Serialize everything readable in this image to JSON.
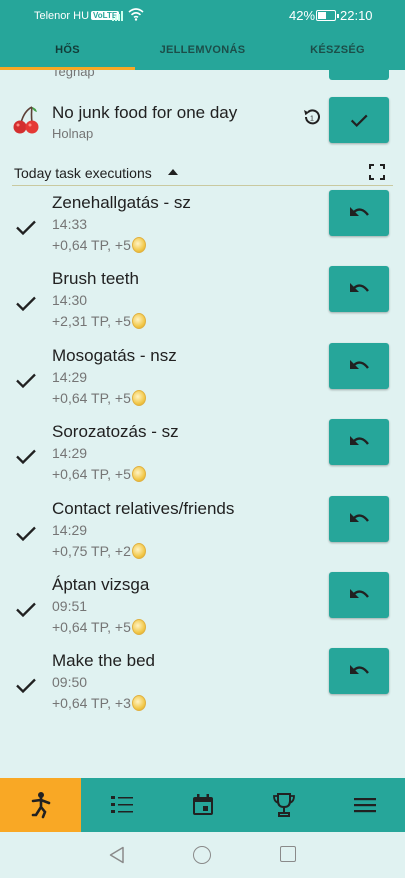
{
  "status_bar": {
    "carrier": "Telenor HU",
    "volte": "VoLTE",
    "battery_percent": "42%",
    "battery_level": 0.42,
    "time": "22:10"
  },
  "tabs": [
    {
      "label": "HŐS",
      "active": true
    },
    {
      "label": "JELLEMVONÁS",
      "active": false
    },
    {
      "label": "KÉSZSÉG",
      "active": false
    }
  ],
  "previous_row": {
    "subtitle": "Tegnap"
  },
  "habit": {
    "icon": "cherry-icon",
    "title": "No junk food for one day",
    "subtitle": "Holnap"
  },
  "section": {
    "title": "Today task executions"
  },
  "tasks": [
    {
      "title": "Zenehallgatás - sz",
      "time": "14:33",
      "reward": "+0,64 TP, +5"
    },
    {
      "title": "Brush teeth",
      "time": "14:30",
      "reward": "+2,31 TP, +5"
    },
    {
      "title": "Mosogatás - nsz",
      "time": "14:29",
      "reward": "+0,64 TP, +5"
    },
    {
      "title": "Sorozatozás - sz",
      "time": "14:29",
      "reward": "+0,64 TP, +5"
    },
    {
      "title": "Contact relatives/friends",
      "time": "14:29",
      "reward": "+0,75 TP, +2"
    },
    {
      "title": "Áptan vizsga",
      "time": "09:51",
      "reward": "+0,64 TP, +5"
    },
    {
      "title": "Make the bed",
      "time": "09:50",
      "reward": "+0,64 TP, +3"
    }
  ],
  "bottom_nav": [
    {
      "icon": "hero-icon",
      "active": true
    },
    {
      "icon": "list-icon",
      "active": false
    },
    {
      "icon": "calendar-icon",
      "active": false
    },
    {
      "icon": "trophy-icon",
      "active": false
    },
    {
      "icon": "menu-icon",
      "active": false
    }
  ],
  "colors": {
    "primary": "#26a69a",
    "accent": "#f9a825",
    "background": "#e0f2f1"
  }
}
